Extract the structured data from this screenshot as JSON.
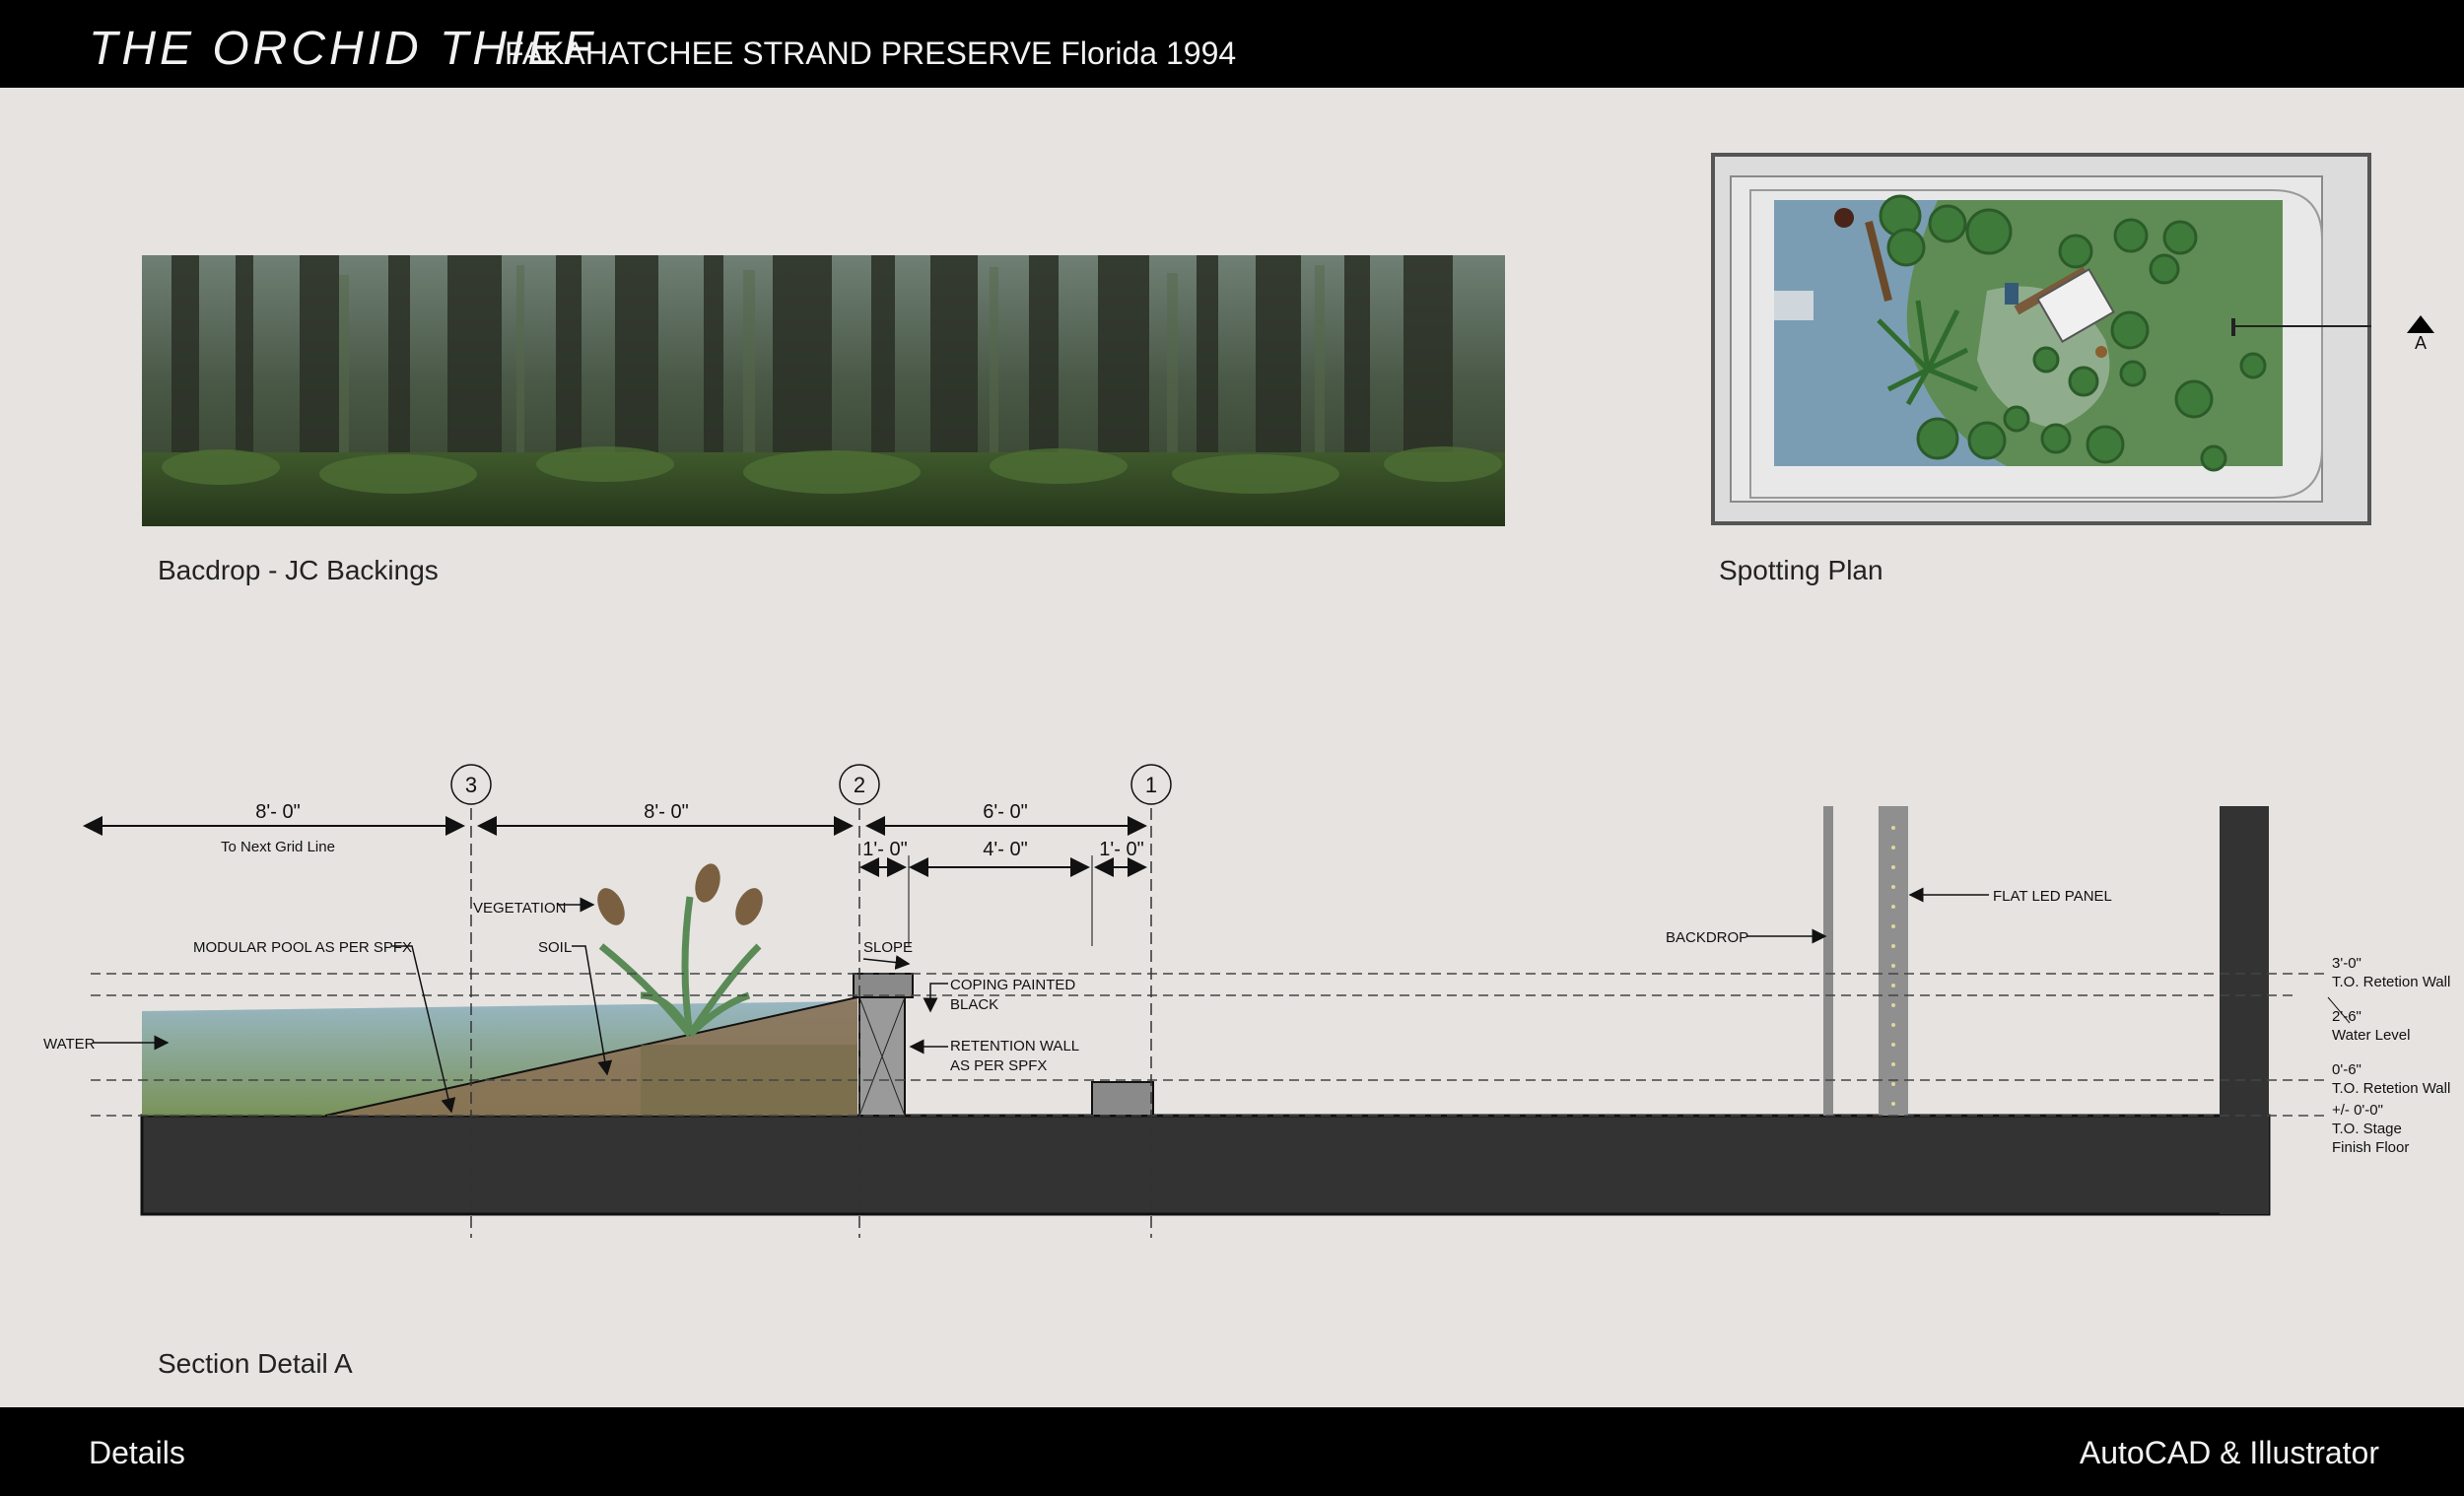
{
  "header": {
    "title": "THE ORCHID THIEF",
    "subtitle": "FAKAHATCHEE STRAND PRESERVE  Florida  1994"
  },
  "captions": {
    "backdrop": "Bacdrop - JC Backings",
    "spotting": "Spotting Plan",
    "section": "Section Detail A"
  },
  "footer": {
    "left": "Details",
    "right": "AutoCAD & Illustrator"
  },
  "spotting_plan": {
    "section_marker": "A"
  },
  "section_detail": {
    "grid_markers": [
      "3",
      "2",
      "1"
    ],
    "dimensions": {
      "d1": "8'- 0\"",
      "d1_note": "To Next Grid Line",
      "d2": "8'- 0\"",
      "d3": "6'- 0\"",
      "d4": "1'- 0\"",
      "d5": "4'- 0\"",
      "d6": "1'- 0\""
    },
    "labels": {
      "vegetation": "VEGETATION",
      "modular_pool": "MODULAR POOL AS PER SPFX",
      "soil": "SOIL",
      "water": "WATER",
      "slope": "SLOPE",
      "coping_1": "COPING PAINTED",
      "coping_2": "BLACK",
      "retention_1": "RETENTION WALL",
      "retention_2": "AS PER SPFX",
      "backdrop": "BACKDROP",
      "led_panel": "FLAT LED PANEL"
    },
    "levels": {
      "l1_value": "3'-0\"",
      "l1_text": "T.O. Retetion Wall",
      "l2_value": "2'-6\"",
      "l2_text": "Water Level",
      "l3_value": "0'-6\"",
      "l3_text": "T.O. Retetion Wall",
      "l4_value": "+/- 0'-0\"",
      "l4_text_1": "T.O. Stage",
      "l4_text_2": "Finish Floor"
    }
  }
}
